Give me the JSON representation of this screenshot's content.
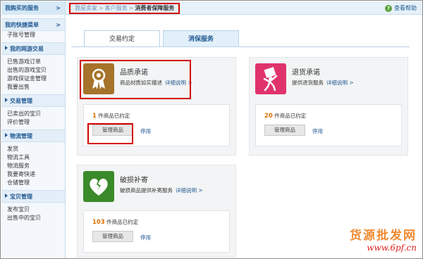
{
  "topbar": {
    "section_title": "我购买的服务",
    "section_arrow": ">",
    "breadcrumb": [
      "我是卖家",
      "客户服务",
      "消费者保障服务"
    ],
    "breadcrumb_sep": ">",
    "help": "查看帮助"
  },
  "sidebar": {
    "groups": [
      {
        "title": "我的快捷菜单",
        "arrow": ">",
        "items": [
          "子账号管理"
        ]
      },
      {
        "title": "我的网游交易",
        "items": [
          "已售游戏订单",
          "出售的游戏宝贝",
          "游戏保证金管理",
          "我要出售"
        ]
      },
      {
        "title": "交易管理",
        "items": [
          "已卖出的宝贝",
          "评价管理"
        ]
      },
      {
        "title": "物流管理",
        "items": [
          "发货",
          "物流工具",
          "物流服务",
          "我要寄快递",
          "仓储管理"
        ]
      },
      {
        "title": "宝贝管理",
        "items": [
          "发布宝贝",
          "出售中的宝贝"
        ]
      }
    ]
  },
  "tabs": [
    {
      "label": "交易约定"
    },
    {
      "label": "消保服务"
    }
  ],
  "cards": [
    {
      "title": "品质承诺",
      "desc": "商品材质如实描述",
      "link": "详细说明 >",
      "count": "1",
      "count_suffix": "件商品已约定",
      "manage": "管理商品",
      "disable": "停用",
      "icon": "award-ribbon-icon",
      "color": "#a6732a"
    },
    {
      "title": "退货承诺",
      "desc": "提供退货服务",
      "link": "详细说明 >",
      "count": "20",
      "count_suffix": "件商品已约定",
      "manage": "管理商品",
      "disable": "停用",
      "icon": "return-box-icon",
      "color": "#e0336b"
    },
    {
      "title": "破损补寄",
      "desc": "破损商品提供补寄服务",
      "link": "详细说明 >",
      "count": "103",
      "count_suffix": "件商品已约定",
      "manage": "管理商品",
      "disable": "停用",
      "icon": "broken-heart-icon",
      "color": "#3a8a2a"
    }
  ],
  "watermark": {
    "line1": "货源批发网",
    "line2": "www.6pf.cn"
  }
}
